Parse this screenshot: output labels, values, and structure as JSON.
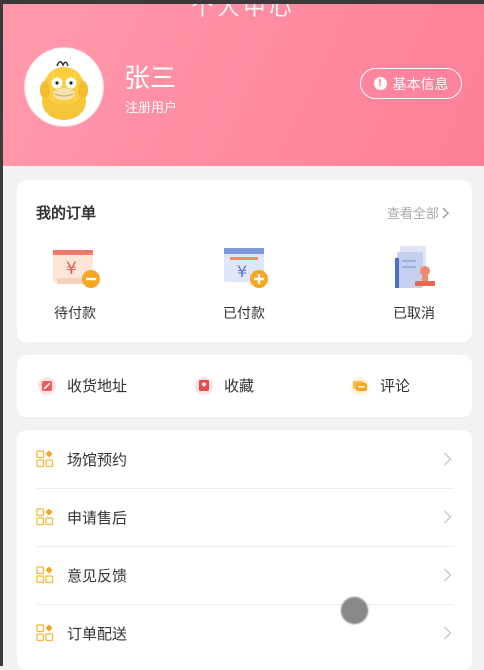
{
  "header": {
    "title": "个人中心",
    "user_name": "张三",
    "user_role": "注册用户",
    "info_button": "基本信息",
    "info_icon": "exclamation-icon"
  },
  "orders": {
    "title": "我的订单",
    "view_all": "查看全部",
    "items": [
      {
        "label": "待付款",
        "icon": "pending-payment-icon"
      },
      {
        "label": "已付款",
        "icon": "paid-icon"
      },
      {
        "label": "已取消",
        "icon": "cancelled-icon"
      }
    ]
  },
  "shortcuts": [
    {
      "label": "收货地址",
      "icon": "address-icon"
    },
    {
      "label": "收藏",
      "icon": "favorite-icon"
    },
    {
      "label": "评论",
      "icon": "comment-icon"
    }
  ],
  "menu": [
    {
      "label": "场馆预约",
      "icon": "grid-icon"
    },
    {
      "label": "申请售后",
      "icon": "grid-icon"
    },
    {
      "label": "意见反馈",
      "icon": "grid-icon"
    },
    {
      "label": "订单配送",
      "icon": "grid-icon"
    }
  ],
  "colors": {
    "header_start": "#ff9aad",
    "header_end": "#fe7f97",
    "accent_orange": "#f5a623",
    "page_bg": "#f2f2f2"
  }
}
